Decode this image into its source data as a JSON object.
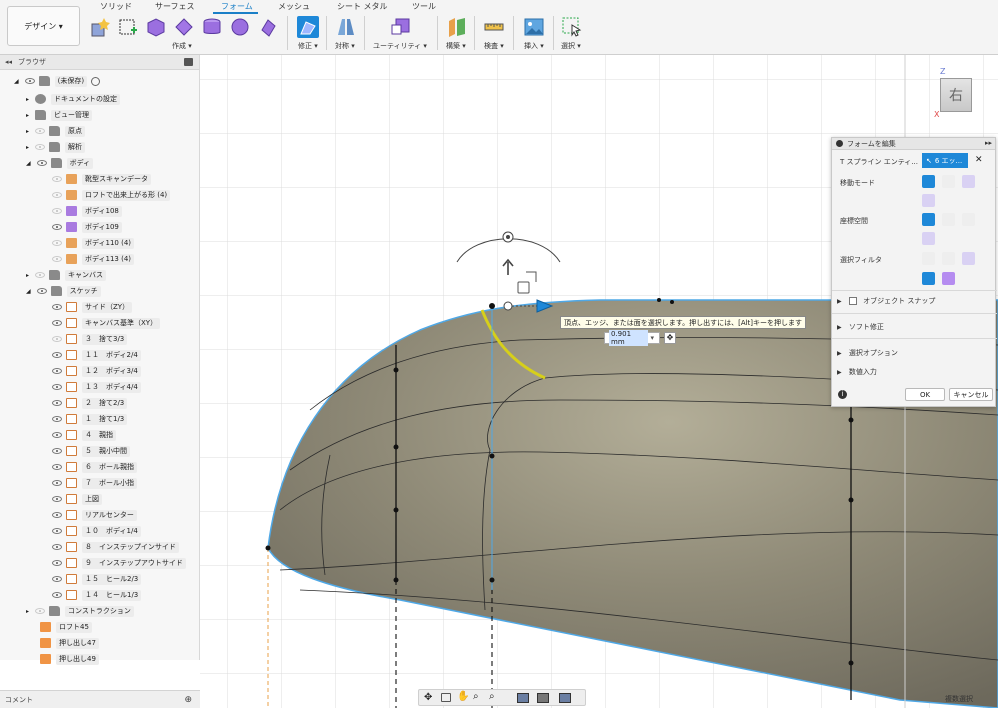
{
  "toolbar": {
    "workspace_label": "デザイン ▾",
    "tabs": [
      "ソリッド",
      "サーフェス",
      "フォーム",
      "メッシュ",
      "シート メタル",
      "ツール"
    ],
    "active_tab": "フォーム",
    "groups": {
      "create": "作成 ▾",
      "modify": "修正 ▾",
      "symmetry": "対称 ▾",
      "utility": "ユーティリティ ▾",
      "construct": "構築 ▾",
      "inspect": "検査 ▾",
      "insert": "挿入 ▾",
      "select": "選択 ▾"
    }
  },
  "browser": {
    "title": "ブラウザ",
    "root": "(未保存)",
    "items": [
      {
        "label": "ドキュメントの設定"
      },
      {
        "label": "ビュー管理"
      },
      {
        "label": "原点"
      },
      {
        "label": "解析"
      },
      {
        "label": "ボディ"
      },
      {
        "label": "靴型スキャンデータ"
      },
      {
        "label": "ロフトで出来上がる形 (4)"
      },
      {
        "label": "ボディ108"
      },
      {
        "label": "ボディ109"
      },
      {
        "label": "ボディ110 (4)"
      },
      {
        "label": "ボディ113 (4)"
      },
      {
        "label": "キャンバス"
      },
      {
        "label": "スケッチ"
      },
      {
        "label": "サイド（ZY）"
      },
      {
        "label": "キャンバス基準（XY）"
      },
      {
        "label": "３　捨て3/3"
      },
      {
        "label": "１１　ボディ2/4"
      },
      {
        "label": "１２　ボディ3/4"
      },
      {
        "label": "１３　ボディ4/4"
      },
      {
        "label": "２　捨て2/3"
      },
      {
        "label": "１　捨て1/3"
      },
      {
        "label": "４　親指"
      },
      {
        "label": "５　親小中間"
      },
      {
        "label": "６　ボール親指"
      },
      {
        "label": "７　ボール小指"
      },
      {
        "label": "上図"
      },
      {
        "label": "リアルセンター"
      },
      {
        "label": "１０　ボディ1/4"
      },
      {
        "label": "８　インステップインサイド"
      },
      {
        "label": "９　インステップアウトサイド"
      },
      {
        "label": "１５　ヒール2/3"
      },
      {
        "label": "１４　ヒール1/3"
      },
      {
        "label": "コンストラクション"
      },
      {
        "label": "ロフト45"
      },
      {
        "label": "押し出し47"
      },
      {
        "label": "押し出し49"
      }
    ]
  },
  "comment": {
    "label": "コメント"
  },
  "form_panel": {
    "title": "フォームを編集",
    "tspline_label": "T スプライン エンティ...",
    "tspline_value": "6 エッ...",
    "move_mode": "移動モード",
    "coord_space": "座標空間",
    "select_filter": "選択フィルタ",
    "object_snap": "オブジェクト スナップ",
    "soft_modify": "ソフト修正",
    "select_options": "選択オプション",
    "numeric_input": "数値入力",
    "ok": "OK",
    "cancel": "キャンセル"
  },
  "tooltip": "頂点、エッジ、または面を選択します。押し出すには、[Alt]キーを押します",
  "dimension": "0.901 mm",
  "viewcube": {
    "face": "右",
    "axis_z": "Z",
    "axis_x": "X"
  },
  "status": "複数選択",
  "colors": {
    "accent": "#1a7fc7",
    "body": "#8e8a79",
    "edge_blue": "#4fa8e6",
    "highlight": "#d6cf1a"
  }
}
